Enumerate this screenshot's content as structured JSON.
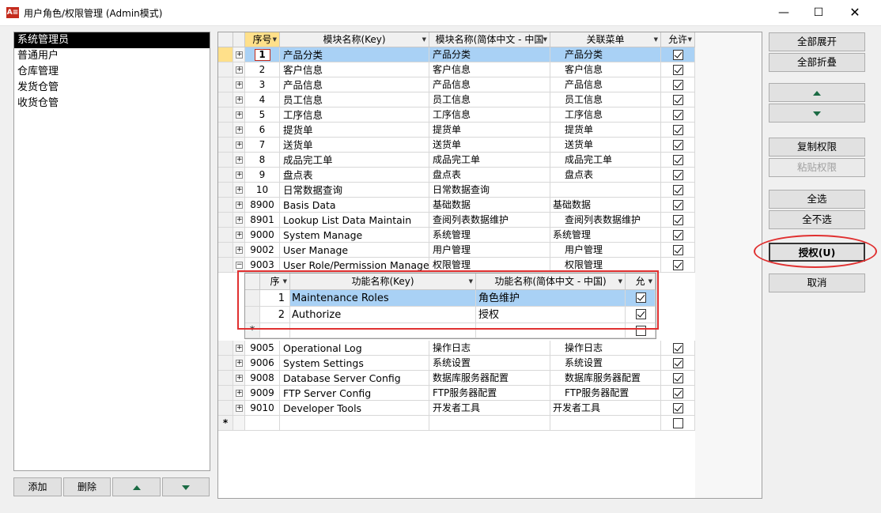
{
  "window": {
    "title": "用户角色/权限管理 (Admin模式)",
    "app_icon": "A≡",
    "minimize_glyph": "—",
    "maximize_glyph": "☐",
    "close_glyph": "✕"
  },
  "roles": {
    "items": [
      "系统管理员",
      "普通用户",
      "仓库管理",
      "发货仓管",
      "收货仓管"
    ],
    "selected_index": 0,
    "add_label": "添加",
    "delete_label": "删除"
  },
  "grid": {
    "headers": {
      "no": "序号",
      "key": "模块名称(Key)",
      "cn": "模块名称(简体中文 - 中国",
      "menu": "关联菜单",
      "allow": "允许"
    },
    "rows": [
      {
        "no": "1",
        "key": "产品分类",
        "cn": "产品分类",
        "menu": "产品分类",
        "allow": true
      },
      {
        "no": "2",
        "key": "客户信息",
        "cn": "客户信息",
        "menu": "客户信息",
        "allow": true
      },
      {
        "no": "3",
        "key": "产品信息",
        "cn": "产品信息",
        "menu": "产品信息",
        "allow": true
      },
      {
        "no": "4",
        "key": "员工信息",
        "cn": "员工信息",
        "menu": "员工信息",
        "allow": true
      },
      {
        "no": "5",
        "key": "工序信息",
        "cn": "工序信息",
        "menu": "工序信息",
        "allow": true
      },
      {
        "no": "6",
        "key": "提货单",
        "cn": "提货单",
        "menu": "提货单",
        "allow": true
      },
      {
        "no": "7",
        "key": "送货单",
        "cn": "送货单",
        "menu": "送货单",
        "allow": true
      },
      {
        "no": "8",
        "key": "成品完工单",
        "cn": "成品完工单",
        "menu": "成品完工单",
        "allow": true
      },
      {
        "no": "9",
        "key": "盘点表",
        "cn": "盘点表",
        "menu": "盘点表",
        "allow": true
      },
      {
        "no": "10",
        "key": "日常数据查询",
        "cn": "日常数据查询",
        "menu": "",
        "allow": true
      },
      {
        "no": "8900",
        "key": "Basis Data",
        "cn": "基础数据",
        "menu": "基础数据",
        "allow": true
      },
      {
        "no": "8901",
        "key": "Lookup List Data Maintain",
        "cn": "查阅列表数据维护",
        "menu": "查阅列表数据维护",
        "allow": true
      },
      {
        "no": "9000",
        "key": "System Manage",
        "cn": "系统管理",
        "menu": "系统管理",
        "allow": true
      },
      {
        "no": "9002",
        "key": "User Manage",
        "cn": "用户管理",
        "menu": "用户管理",
        "allow": true
      },
      {
        "no": "9003",
        "key": "User Role/Permission Manage",
        "cn": "权限管理",
        "menu": "权限管理",
        "allow": true
      },
      {
        "no": "9005",
        "key": "Operational Log",
        "cn": "操作日志",
        "menu": "操作日志",
        "allow": true
      },
      {
        "no": "9006",
        "key": "System Settings",
        "cn": "系统设置",
        "menu": "系统设置",
        "allow": true
      },
      {
        "no": "9008",
        "key": "Database Server Config",
        "cn": "数据库服务器配置",
        "menu": "数据库服务器配置",
        "allow": true
      },
      {
        "no": "9009",
        "key": "FTP Server Config",
        "cn": "FTP服务器配置",
        "menu": "FTP服务器配置",
        "allow": true
      },
      {
        "no": "9010",
        "key": "Developer Tools",
        "cn": "开发者工具",
        "menu": "开发者工具",
        "allow": true
      }
    ],
    "new_row_marker": "*"
  },
  "subgrid": {
    "headers": {
      "no": "序",
      "key": "功能名称(Key)",
      "cn": "功能名称(简体中文 - 中国)",
      "allow": "允"
    },
    "rows": [
      {
        "no": "1",
        "key": "Maintenance Roles",
        "cn": "角色维护",
        "allow": true
      },
      {
        "no": "2",
        "key": "Authorize",
        "cn": "授权",
        "allow": true
      }
    ],
    "new_row_marker": "*"
  },
  "actions": {
    "expand_all": "全部展开",
    "collapse_all": "全部折叠",
    "copy_perm": "复制权限",
    "paste_perm": "粘贴权限",
    "select_all": "全选",
    "deselect_all": "全不选",
    "authorize": "授权(U)",
    "cancel": "取消"
  },
  "colors": {
    "highlight_row": "#a9d1f5",
    "annotation_red": "#e03030",
    "arrow_green": "#1b6b44"
  }
}
